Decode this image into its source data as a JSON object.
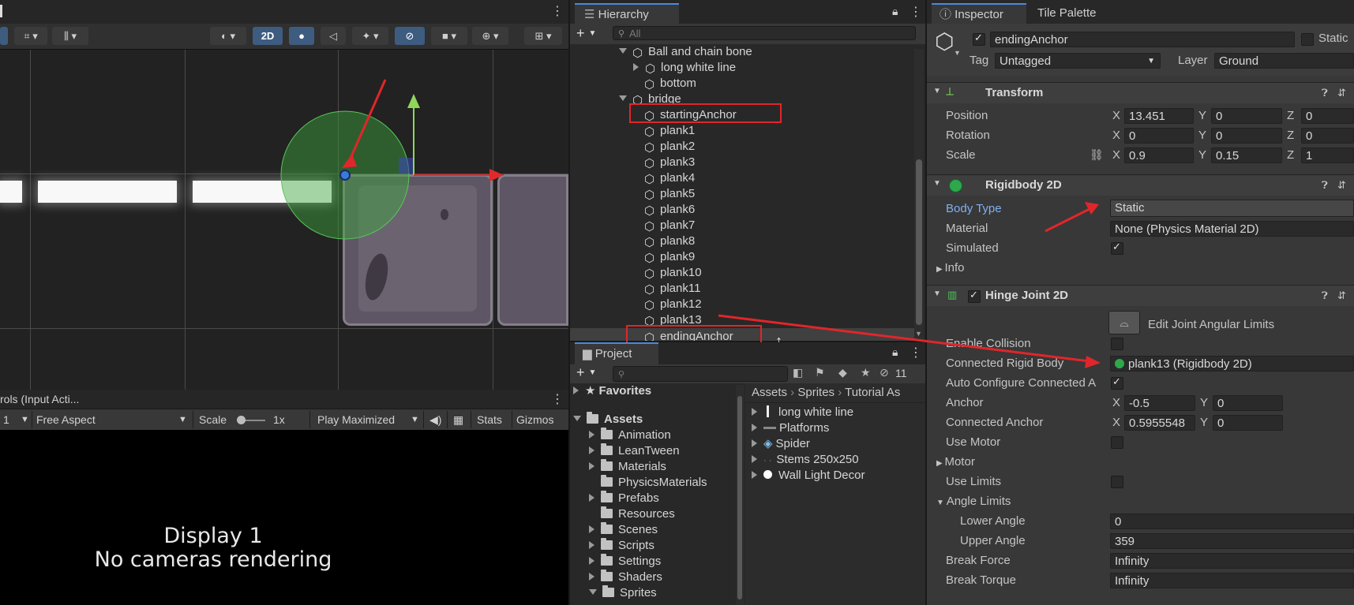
{
  "scene": {
    "toolbar": {
      "mode_2d": "2D"
    },
    "gizmo_colors": {
      "x_axis": "#e02a2a",
      "y_axis": "#8fd65a",
      "circle": "#3fa83f"
    }
  },
  "game": {
    "tab_label": "rols (Input Acti...",
    "display_index": "1",
    "aspect": "Free Aspect",
    "scale_label": "Scale",
    "scale_value": "1x",
    "play_mode": "Play Maximized",
    "stats": "Stats",
    "gizmos": "Gizmos",
    "display_line1": "Display 1",
    "display_line2": "No cameras rendering"
  },
  "hierarchy": {
    "tab": "Hierarchy",
    "search_placeholder": "All",
    "items": [
      {
        "label": "Ball and chain bone"
      },
      {
        "label": "long white line"
      },
      {
        "label": "bottom"
      },
      {
        "label": "bridge"
      },
      {
        "label": "startingAnchor"
      },
      {
        "label": "plank1"
      },
      {
        "label": "plank2"
      },
      {
        "label": "plank3"
      },
      {
        "label": "plank4"
      },
      {
        "label": "plank5"
      },
      {
        "label": "plank6"
      },
      {
        "label": "plank7"
      },
      {
        "label": "plank8"
      },
      {
        "label": "plank9"
      },
      {
        "label": "plank10"
      },
      {
        "label": "plank11"
      },
      {
        "label": "plank12"
      },
      {
        "label": "plank13"
      },
      {
        "label": "endingAnchor"
      }
    ]
  },
  "project": {
    "tab": "Project",
    "hidden_count": "11",
    "favorites": "Favorites",
    "assets": "Assets",
    "folders": [
      "Animation",
      "LeanTween",
      "Materials",
      "PhysicsMaterials",
      "Prefabs",
      "Resources",
      "Scenes",
      "Scripts",
      "Settings",
      "Shaders",
      "Sprites"
    ],
    "breadcrumb": [
      "Assets",
      "Sprites",
      "Tutorial As"
    ],
    "files": [
      "long white line",
      "Platforms",
      "Spider",
      "Stems 250x250",
      "Wall Light Decor"
    ]
  },
  "inspector": {
    "tab_inspector": "Inspector",
    "tab_tile_palette": "Tile Palette",
    "object_name": "endingAnchor",
    "static_label": "Static",
    "tag_label": "Tag",
    "tag_value": "Untagged",
    "layer_label": "Layer",
    "layer_value": "Ground",
    "transform": {
      "title": "Transform",
      "position_label": "Position",
      "rotation_label": "Rotation",
      "scale_label": "Scale",
      "position": {
        "x": "13.451",
        "y": "0",
        "z": "0"
      },
      "rotation": {
        "x": "0",
        "y": "0",
        "z": "0"
      },
      "scale": {
        "x": "0.9",
        "y": "0.15",
        "z": "1"
      }
    },
    "rigidbody": {
      "title": "Rigidbody 2D",
      "body_type_label": "Body Type",
      "body_type": "Static",
      "material_label": "Material",
      "material": "None (Physics Material 2D)",
      "simulated_label": "Simulated",
      "simulated": true,
      "info_label": "Info"
    },
    "hinge": {
      "title": "Hinge Joint 2D",
      "edit_limits": "Edit Joint Angular Limits",
      "enable_collision_label": "Enable Collision",
      "connected_rb_label": "Connected Rigid Body",
      "connected_rb": "plank13 (Rigidbody 2D)",
      "auto_configure_label": "Auto Configure Connected A",
      "anchor_label": "Anchor",
      "anchor": {
        "x": "-0.5",
        "y": "0"
      },
      "connected_anchor_label": "Connected Anchor",
      "connected_anchor": {
        "x": "0.5955548",
        "y": "0"
      },
      "use_motor_label": "Use Motor",
      "motor_label": "Motor",
      "use_limits_label": "Use Limits",
      "angle_limits_label": "Angle Limits",
      "lower_angle_label": "Lower Angle",
      "lower_angle": "0",
      "upper_angle_label": "Upper Angle",
      "upper_angle": "359",
      "break_force_label": "Break Force",
      "break_force": "Infinity",
      "break_torque_label": "Break Torque",
      "break_torque": "Infinity"
    },
    "axis_labels": {
      "x": "X",
      "y": "Y",
      "z": "Z"
    }
  },
  "annotation_color": "#e0262a"
}
